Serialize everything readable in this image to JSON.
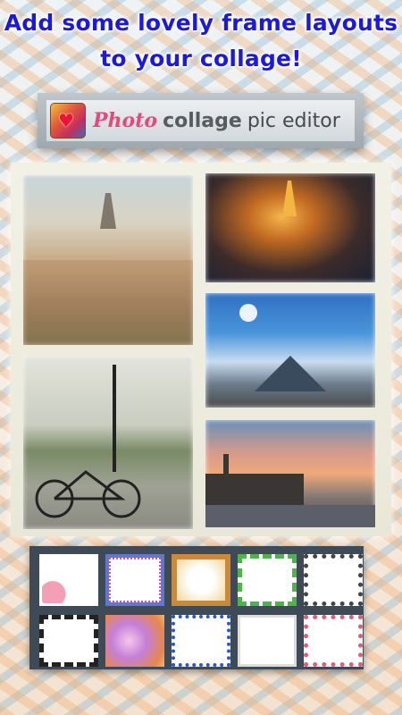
{
  "headline": {
    "line1": "Add some lovely frame layouts",
    "line2": "to your collage!"
  },
  "banner": {
    "title_photo": "Photo",
    "title_collage": "collage",
    "title_rest": "pic editor"
  }
}
